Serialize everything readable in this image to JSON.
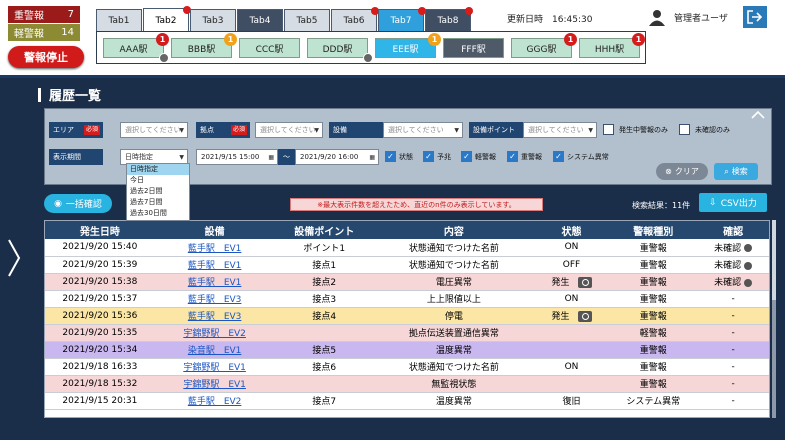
{
  "alarms": {
    "heavy": {
      "label": "重警報",
      "count": "7"
    },
    "light": {
      "label": "軽警報",
      "count": "14"
    },
    "stop_label": "警報停止"
  },
  "tabs": [
    "Tab1",
    "Tab2",
    "Tab3",
    "Tab4",
    "Tab5",
    "Tab6",
    "Tab7",
    "Tab8"
  ],
  "stations": [
    {
      "name": "AAA駅",
      "badge": "1"
    },
    {
      "name": "BBB駅",
      "badge": "1"
    },
    {
      "name": "CCC駅",
      "badge": ""
    },
    {
      "name": "DDD駅",
      "badge": ""
    },
    {
      "name": "EEE駅",
      "badge": "1"
    },
    {
      "name": "FFF駅",
      "badge": ""
    },
    {
      "name": "GGG駅",
      "badge": "1"
    },
    {
      "name": "HHH駅",
      "badge": "1"
    }
  ],
  "header": {
    "updated_label": "更新日時",
    "updated_time": "16:45:30",
    "user_name": "管理者ユーザ"
  },
  "page_title": "履歴一覧",
  "filter": {
    "area_label": "エリア",
    "point_label": "拠点",
    "equip_label": "設備",
    "equip_point_label": "設備ポイント",
    "period_label": "表示期間",
    "required": "必須",
    "placeholder": "選択してください",
    "period_value": "日時指定",
    "period_options": [
      "日時指定",
      "今日",
      "過去2日間",
      "過去7日間",
      "過去30日間"
    ],
    "date_from": "2021/9/15 15:00",
    "date_sep": "〜",
    "date_to": "2021/9/20 16:00",
    "chk_active": "発生中警報のみ",
    "chk_unconfirmed": "未確認のみ",
    "chk_types": [
      "状態",
      "予兆",
      "軽警報",
      "重警報",
      "システム異常"
    ],
    "clear_label": "クリア",
    "search_label": "検索"
  },
  "toolbar": {
    "bulk_label": "一括確認",
    "notice": "※最大表示件数を超えたため、直近のn件のみ表示しています。",
    "results": "検索結果：11件",
    "csv_label": "CSV出力"
  },
  "table": {
    "columns": [
      "発生日時",
      "設備",
      "設備ポイント",
      "内容",
      "状態",
      "警報種別",
      "確認"
    ],
    "rows": [
      {
        "time": "2021/9/20 15:40",
        "equip": "藍手駅　EV1",
        "point": "ポイント1",
        "content": "状態通知でつけた名前",
        "state": "ON",
        "type": "重警報",
        "confirm": "未確認",
        "row_class": "",
        "camera": false,
        "dot": true
      },
      {
        "time": "2021/9/20 15:39",
        "equip": "藍手駅　EV1",
        "point": "接点1",
        "content": "状態通知でつけた名前",
        "state": "OFF",
        "type": "重警報",
        "confirm": "未確認",
        "row_class": "",
        "camera": false,
        "dot": true
      },
      {
        "time": "2021/9/20 15:38",
        "equip": "藍手駅　EV1",
        "point": "接点2",
        "content": "電圧異常",
        "state": "発生",
        "type": "重警報",
        "confirm": "未確認",
        "row_class": "pink",
        "camera": true,
        "dot": true
      },
      {
        "time": "2021/9/20 15:37",
        "equip": "藍手駅　EV3",
        "point": "接点3",
        "content": "上上限値以上",
        "state": "ON",
        "type": "重警報",
        "confirm": "-",
        "row_class": "",
        "camera": false,
        "dot": false
      },
      {
        "time": "2021/9/20 15:36",
        "equip": "藍手駅　EV3",
        "point": "接点4",
        "content": "停電",
        "state": "発生",
        "type": "重警報",
        "confirm": "-",
        "row_class": "yellow",
        "camera": true,
        "dot": false
      },
      {
        "time": "2021/9/20 15:35",
        "equip": "宇錦野駅　EV2",
        "point": "",
        "content": "拠点伝送装置通信異常",
        "state": "",
        "type": "軽警報",
        "confirm": "-",
        "row_class": "pink",
        "camera": false,
        "dot": false
      },
      {
        "time": "2021/9/20 15:34",
        "equip": "染音駅　EV1",
        "point": "接点5",
        "content": "温度異常",
        "state": "",
        "type": "重警報",
        "confirm": "-",
        "row_class": "purple",
        "camera": false,
        "dot": false
      },
      {
        "time": "2021/9/18 16:33",
        "equip": "宇錦野駅　EV1",
        "point": "接点6",
        "content": "状態通知でつけた名前",
        "state": "ON",
        "type": "重警報",
        "confirm": "-",
        "row_class": "",
        "camera": false,
        "dot": false
      },
      {
        "time": "2021/9/18 15:32",
        "equip": "宇錦野駅　EV1",
        "point": "",
        "content": "無監視状態",
        "state": "",
        "type": "重警報",
        "confirm": "-",
        "row_class": "pink",
        "camera": false,
        "dot": false
      },
      {
        "time": "2021/9/15 20:31",
        "equip": "藍手駅　EV2",
        "point": "接点7",
        "content": "温度異常",
        "state": "復旧",
        "type": "システム異常",
        "confirm": "-",
        "row_class": "",
        "camera": false,
        "dot": false
      }
    ]
  }
}
